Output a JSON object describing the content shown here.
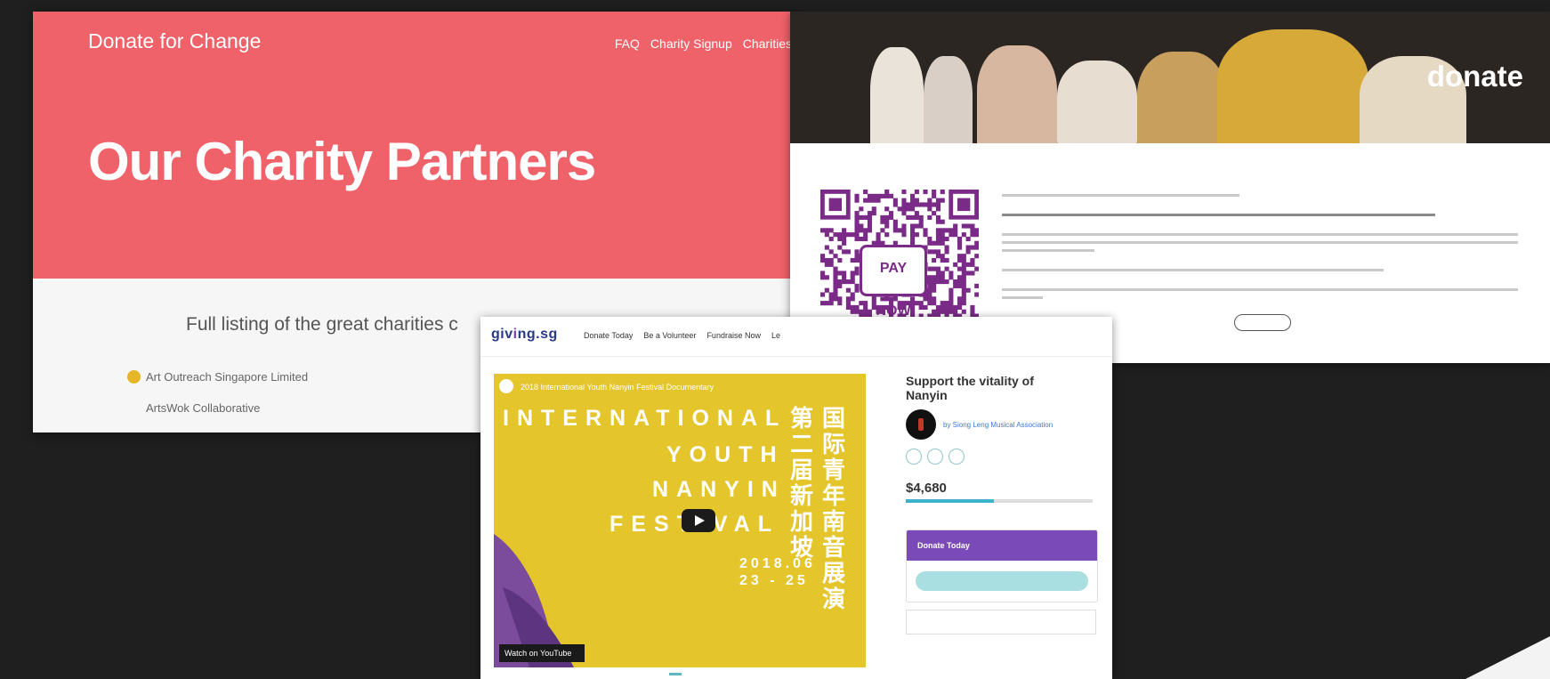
{
  "dfc": {
    "brand": "Donate for Change",
    "nav": [
      "FAQ",
      "Charity Signup",
      "Charities"
    ],
    "hero_title": "Our Charity Partners",
    "lead": "Full listing of the great charities c",
    "list": [
      "Art Outreach Singapore Limited",
      "ArtsWok Collaborative"
    ]
  },
  "donate": {
    "banner_title": "donate",
    "qr_logo": "PAY NOW"
  },
  "giving": {
    "logo_a": "giv",
    "logo_i": "i",
    "logo_b": "ng.sg",
    "nav": [
      "Donate Today",
      "Be a Volunteer",
      "Fundraise Now",
      "Le"
    ],
    "video": {
      "title": "2018 International Youth Nanyin Festival Documentary",
      "line1": "INTERNATIONAL",
      "line2": "YOUTH",
      "line3": "NANYIN",
      "line4": "FESTIVAL",
      "cn1": "第二届新加坡",
      "cn2": "国际青年南音展演",
      "date1": "2018.06",
      "date2": "23 - 25",
      "watch": "Watch on  YouTube"
    },
    "campaign": {
      "title": "Support the vitality of Nanyin",
      "org": "by Siong Leng Musical Association",
      "amount": "$4,680",
      "progress": 0.47
    },
    "donate_box": {
      "header": "Donate Today"
    }
  },
  "colors": {
    "hero": "#f0626a",
    "purple": "#7a4bb8",
    "teal": "#3bb3c8",
    "yellow": "#e4c52c"
  }
}
